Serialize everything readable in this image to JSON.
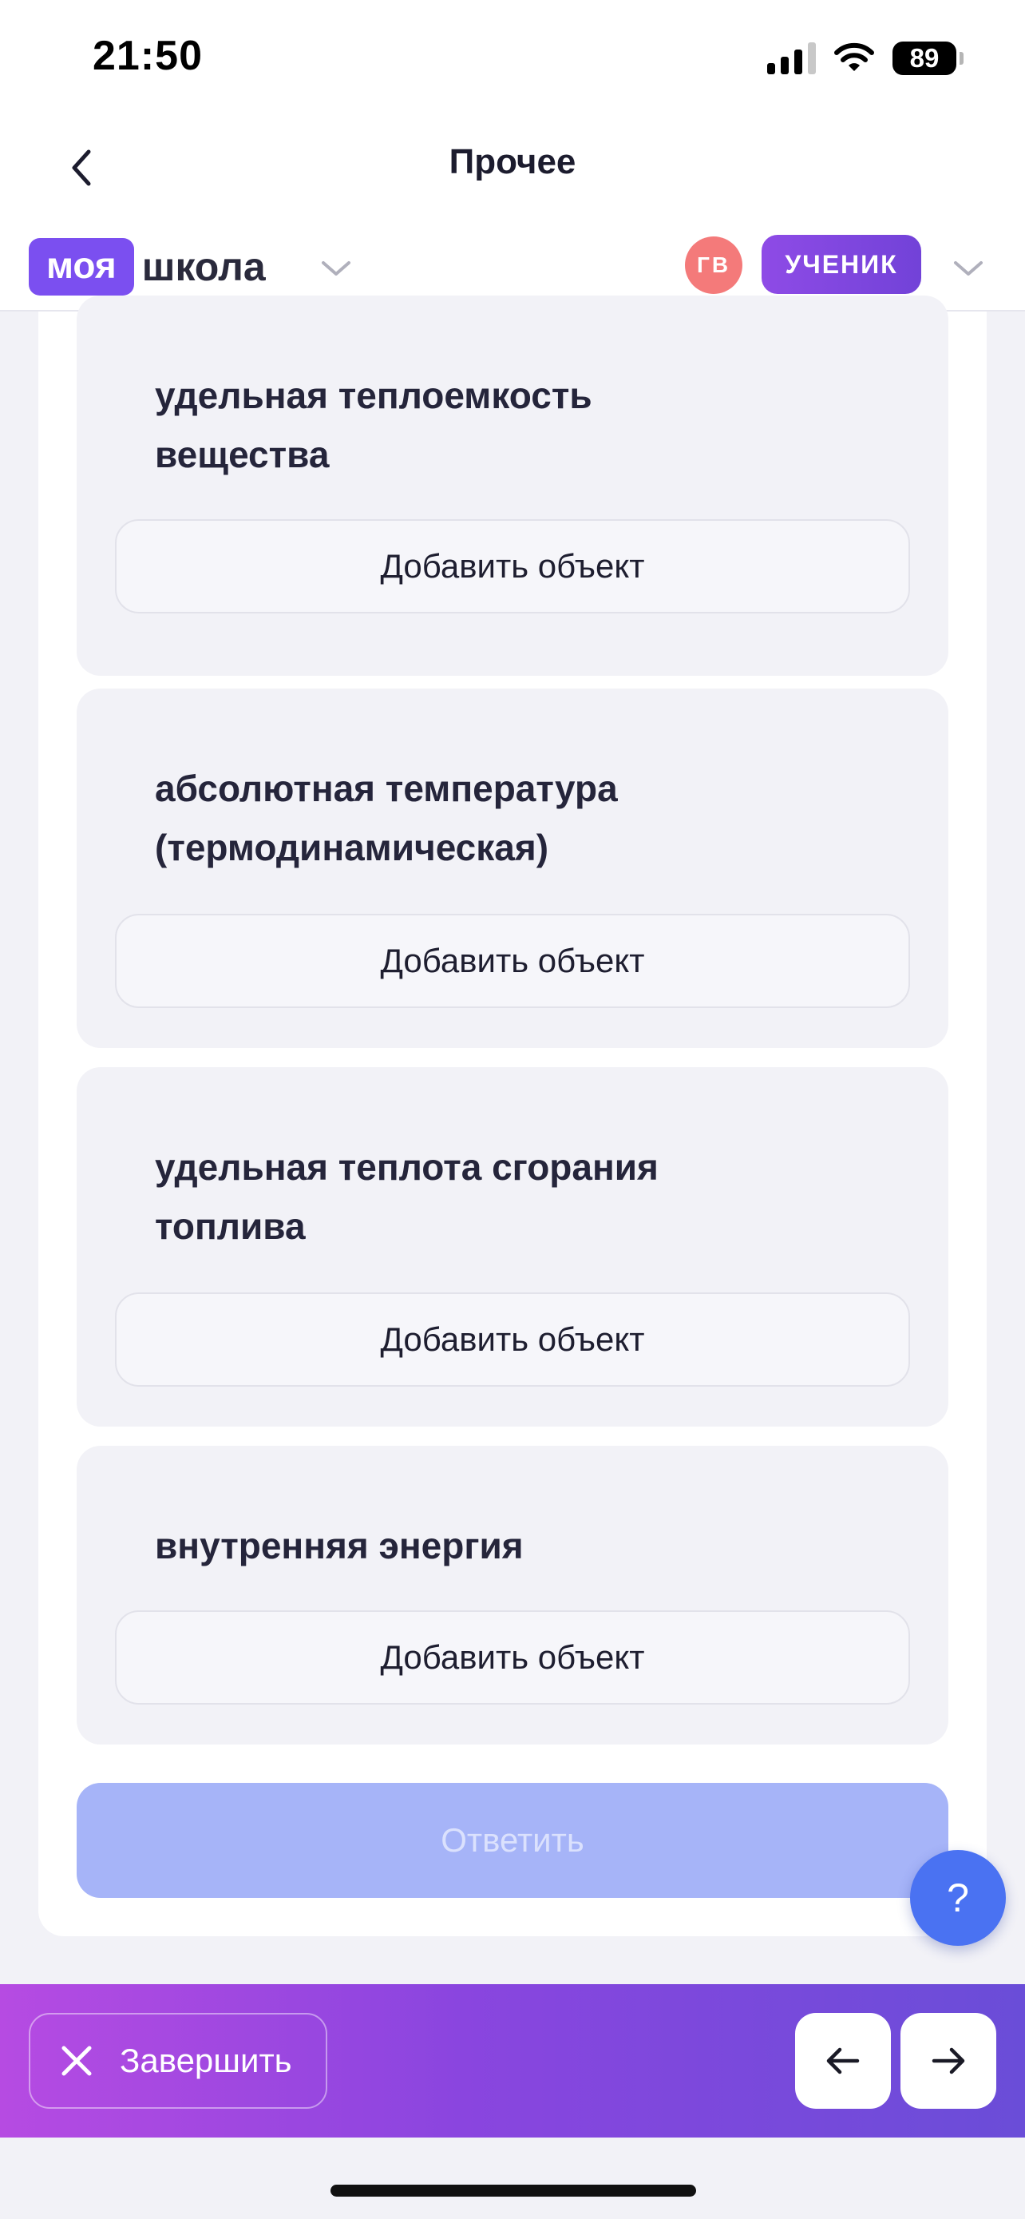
{
  "status_bar": {
    "time": "21:50",
    "battery": "89"
  },
  "nav": {
    "title": "Прочее"
  },
  "brand": {
    "badge": "моя",
    "text": "школа"
  },
  "user": {
    "initials": "ГВ",
    "role": "УЧЕНИК"
  },
  "cards": [
    {
      "title_lines": [
        "удельная теплоемкость",
        "вещества"
      ],
      "button": "Добавить объект"
    },
    {
      "title_lines": [
        "абсолютная температура",
        "(термодинамическая)"
      ],
      "button": "Добавить объект"
    },
    {
      "title_lines": [
        "удельная теплота сгорания",
        "топлива"
      ],
      "button": "Добавить объект"
    },
    {
      "title_lines": [
        "внутренняя энергия"
      ],
      "button": "Добавить объект"
    }
  ],
  "answer_label": "Ответить",
  "help_label": "?",
  "bottom": {
    "finish_label": "Завершить"
  },
  "colors": {
    "brand_purple": "#7b4ff0",
    "answer_disabled": "#a6b4f8",
    "help_blue": "#4a72f2",
    "avatar_red": "#f47a7a"
  }
}
